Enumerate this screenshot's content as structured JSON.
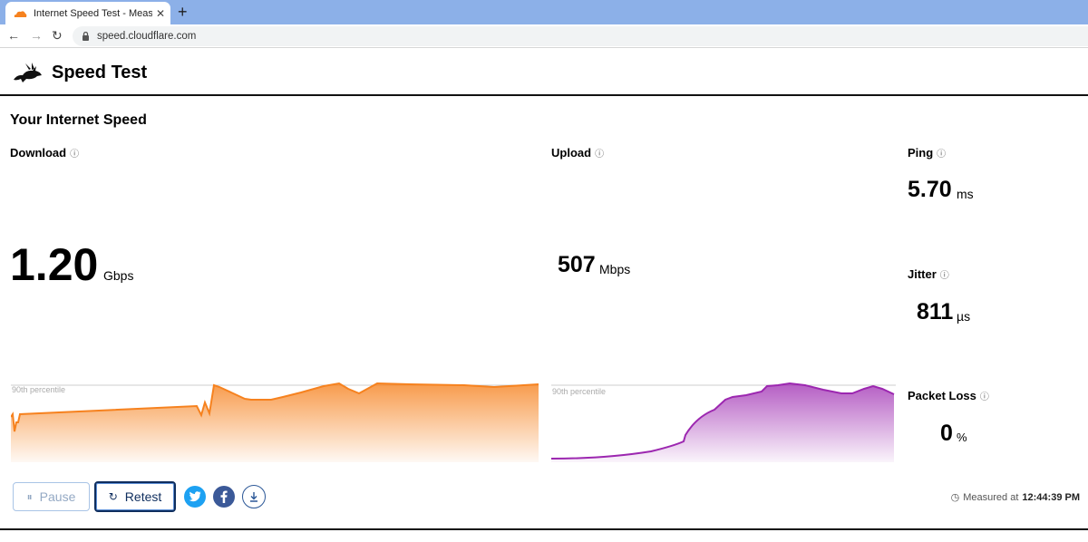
{
  "browser": {
    "tab_title": "Internet Speed Test - Measure Ne",
    "url": "speed.cloudflare.com"
  },
  "site": {
    "title": "Speed Test",
    "section_title": "Your Internet Speed"
  },
  "download": {
    "label": "Download",
    "value": "1.20",
    "unit": "Gbps",
    "percentile_label": "90th percentile",
    "color": "#f6821f"
  },
  "upload": {
    "label": "Upload",
    "value": "507",
    "unit": "Mbps",
    "percentile_label": "90th percentile",
    "color": "#9c27b0"
  },
  "ping": {
    "label": "Ping",
    "value": "5.70",
    "unit": "ms"
  },
  "jitter": {
    "label": "Jitter",
    "value": "811",
    "unit": "µs"
  },
  "packet_loss": {
    "label": "Packet Loss",
    "value": "0",
    "unit": "%"
  },
  "controls": {
    "pause_label": "Pause",
    "retest_label": "Retest"
  },
  "measured": {
    "prefix": "Measured at",
    "time": "12:44:39 PM"
  },
  "icons": [
    "cloudflare-icon",
    "back-icon",
    "forward-icon",
    "reload-icon",
    "lock-icon",
    "rabbit-logo-icon",
    "info-icon",
    "pause-icon",
    "retest-icon",
    "twitter-icon",
    "facebook-icon",
    "download-icon",
    "clock-icon"
  ]
}
